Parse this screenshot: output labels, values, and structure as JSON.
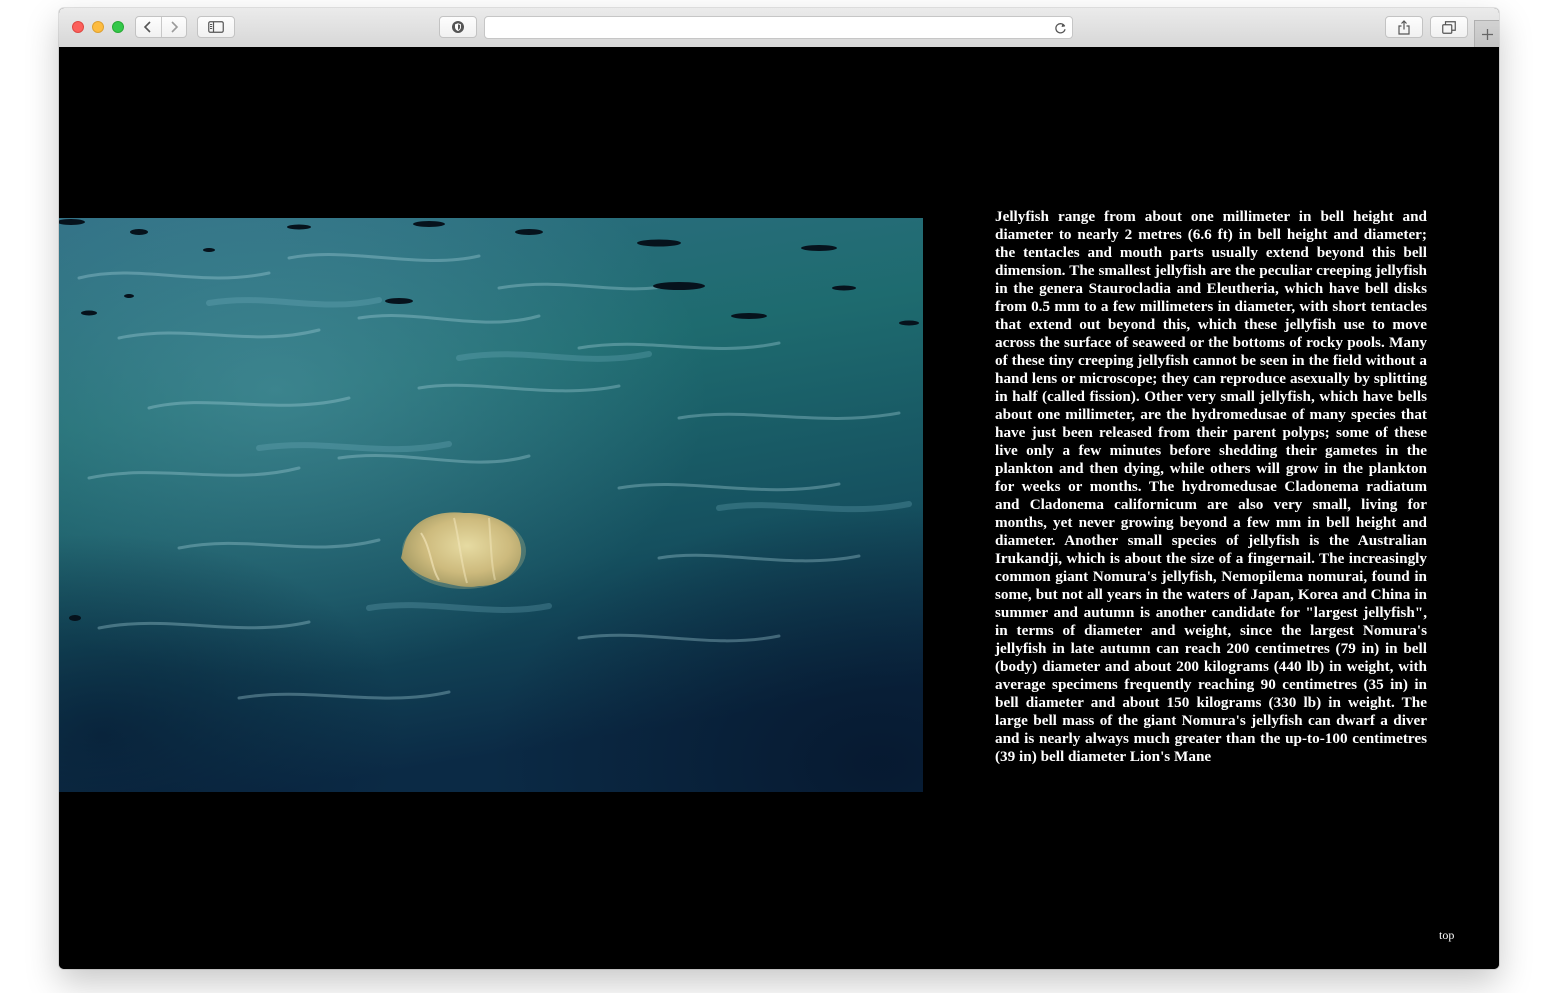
{
  "browser": {
    "url": "",
    "icons": {
      "back": "chevron-left-icon",
      "forward": "chevron-right-icon",
      "sidebar": "sidebar-icon",
      "privacy": "shield-icon",
      "reload": "reload-icon",
      "share": "share-icon",
      "tabs": "tabs-overview-icon",
      "new_tab": "plus-icon"
    }
  },
  "page": {
    "background": "#000000",
    "text_color": "#ffffff",
    "image": {
      "subject": "jellyfish-in-water-photo"
    },
    "article_text": "Jellyfish range from about one millimeter in bell height and diameter to nearly 2 metres (6.6 ft) in bell height and diameter; the tentacles and mouth parts usually extend beyond this bell dimension. The smallest jellyfish are the peculiar creeping jellyfish in the genera Staurocladia and Eleutheria, which have bell disks from 0.5 mm to a few millimeters in diameter, with short tentacles that extend out beyond this, which these jellyfish use to move across the surface of seaweed or the bottoms of rocky pools. Many of these tiny creeping jellyfish cannot be seen in the field without a hand lens or microscope; they can reproduce asexually by splitting in half (called fission). Other very small jellyfish, which have bells about one millimeter, are the hydromedusae of many species that have just been released from their parent polyps; some of these live only a few minutes before shedding their gametes in the plankton and then dying, while others will grow in the plankton for weeks or months. The hydromedusae Cladonema radiatum and Cladonema californicum are also very small, living for months, yet never growing beyond a few mm in bell height and diameter. Another small species of jellyfish is the Australian Irukandji, which is about the size of a fingernail. The increasingly common giant Nomura's jellyfish, Nemopilema nomurai, found in some, but not all years in the waters of Japan, Korea and China in summer and autumn is another candidate for \"largest jellyfish\", in terms of diameter and weight, since the largest Nomura's jellyfish in late autumn can reach 200 centimetres (79 in) in bell (body) diameter and about 200 kilograms (440 lb) in weight, with average specimens frequently reaching 90 centimetres (35 in) in bell diameter and about 150 kilograms (330 lb) in weight. The large bell mass of the giant Nomura's jellyfish can dwarf a diver and is nearly always much greater than the up-to-100 centimetres (39 in) bell diameter Lion's Mane",
    "top_link": "top"
  }
}
